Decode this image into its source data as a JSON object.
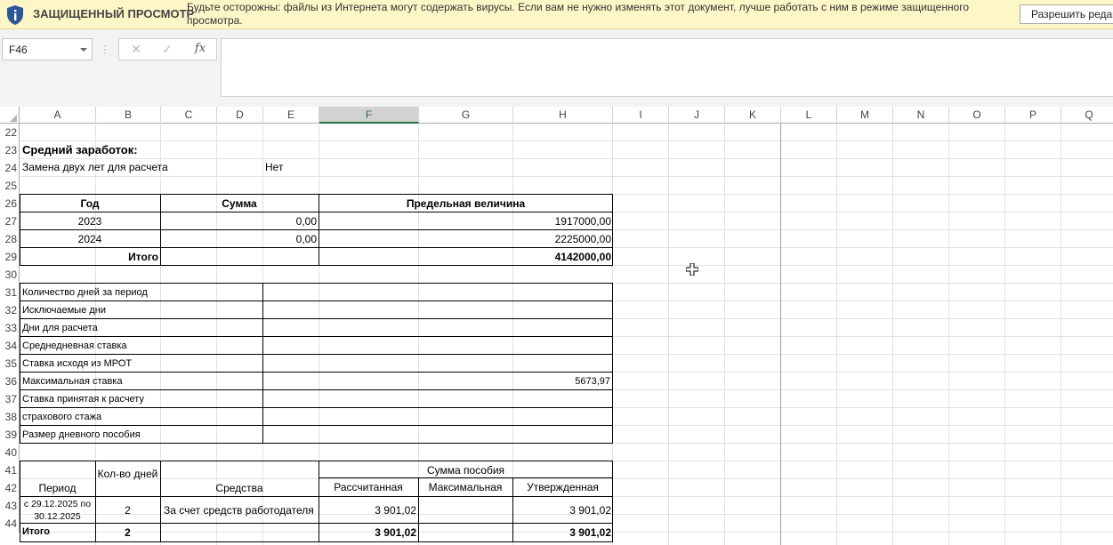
{
  "protected_view": {
    "title": "ЗАЩИЩЕННЫЙ ПРОСМОТР",
    "message": "Будьте осторожны: файлы из Интернета могут содержать вирусы. Если вам не нужно изменять этот документ, лучше работать с ним в режиме защищенного просмотра.",
    "enable_button": "Разрешить редактирование",
    "icon": "shield-info-icon"
  },
  "formula_bar": {
    "name_box": "F46",
    "cancel_icon": "✕",
    "enter_icon": "✓",
    "fx_label": "fx",
    "formula": ""
  },
  "columns": [
    "A",
    "B",
    "C",
    "D",
    "E",
    "F",
    "G",
    "H",
    "I",
    "J",
    "K",
    "L",
    "M",
    "N",
    "O",
    "P",
    "Q"
  ],
  "selected_column": "F",
  "rows": [
    "22",
    "23",
    "24",
    "25",
    "26",
    "27",
    "28",
    "29",
    "30",
    "31",
    "32",
    "33",
    "34",
    "35",
    "36",
    "37",
    "38",
    "39",
    "40",
    "41",
    "42",
    "43",
    "44"
  ],
  "sheet": {
    "avg_earnings_title": "Средний заработок:",
    "replace_two_years_label": "Замена двух лет для расчета",
    "replace_two_years_value": "Нет",
    "earnings_table": {
      "headers": {
        "year": "Год",
        "sum": "Сумма",
        "limit": "Предельная величина"
      },
      "rows": [
        {
          "year": "2023",
          "sum": "0,00",
          "limit": "1917000,00"
        },
        {
          "year": "2024",
          "sum": "0,00",
          "limit": "2225000,00"
        }
      ],
      "total_label": "Итого",
      "total_limit": "4142000,00"
    },
    "params": [
      {
        "label": "Количество дней за период",
        "value": ""
      },
      {
        "label": "Исключаемые дни",
        "value": ""
      },
      {
        "label": "Дни для расчета",
        "value": ""
      },
      {
        "label": "Среднедневная ставка",
        "value": ""
      },
      {
        "label": "Ставка исходя из МРОТ",
        "value": ""
      },
      {
        "label": "Максимальная ставка",
        "value": "5673,97"
      },
      {
        "label": "Ставка принятая к расчету",
        "value": ""
      },
      {
        "label": "страхового стажа",
        "value": ""
      },
      {
        "label": "Размер дневного пособия",
        "value": ""
      }
    ],
    "benefit_table": {
      "period": "Период",
      "days": "Кол-во дней",
      "funds": "Средства",
      "sum_group": "Сумма пособия",
      "calculated": "Рассчитанная",
      "maximum": "Максимальная",
      "approved": "Утвержденная",
      "row": {
        "period": "с 29.12.2025 по 30.12.2025",
        "days": "2",
        "funds": "За счет средств работодателя",
        "calculated": "3 901,02",
        "maximum": "",
        "approved": "3 901,02"
      },
      "total": {
        "label": "Итого",
        "days": "2",
        "calculated": "3 901,02",
        "approved": "3 901,02"
      }
    }
  }
}
